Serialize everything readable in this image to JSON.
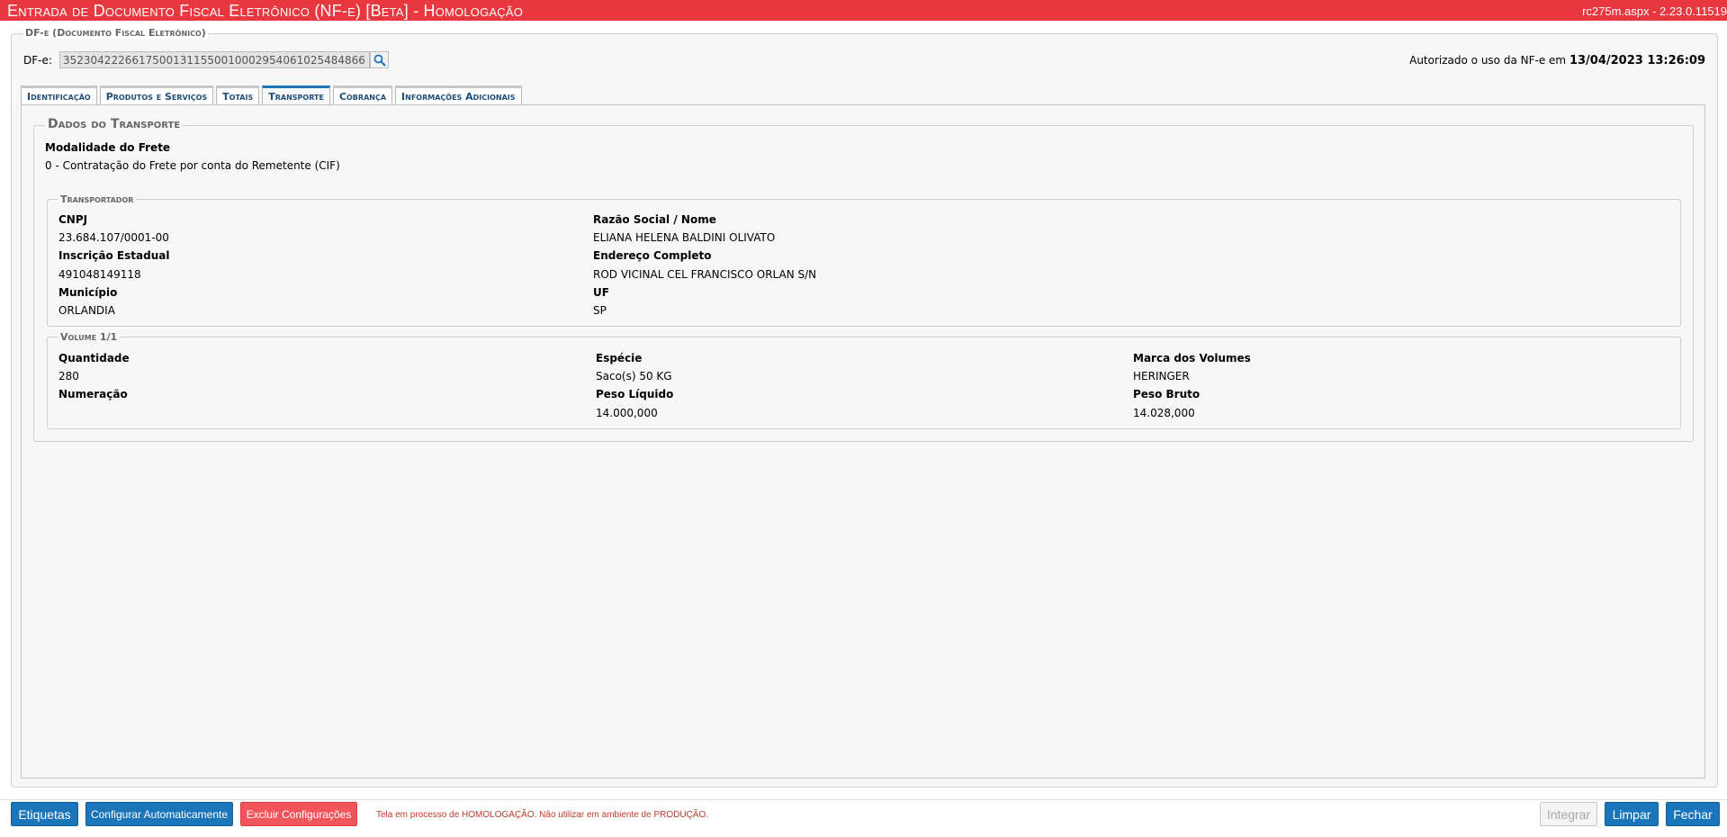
{
  "header": {
    "title": "Entrada de Documento Fiscal Eletrônico (NF-e) [Beta]  - Homologação",
    "version": "rc275m.aspx - 2.23.0.11519"
  },
  "dfe": {
    "legend": "DF-e (Documento Fiscal Eletrônico)",
    "label": "DF-e:",
    "value": "35230422266175001311550010002954061025484866",
    "autorizado_text": "Autorizado o uso da NF-e em",
    "autorizado_datetime": "13/04/2023 13:26:09"
  },
  "tabs": [
    {
      "label": "Identificação",
      "active": false
    },
    {
      "label": "Produtos e Serviços",
      "active": false
    },
    {
      "label": "Totais",
      "active": false
    },
    {
      "label": "Transporte",
      "active": true
    },
    {
      "label": "Cobrança",
      "active": false
    },
    {
      "label": "Informações Adicionais",
      "active": false
    }
  ],
  "transporte": {
    "legend": "Dados do Transporte",
    "modalidade_label": "Modalidade do Frete",
    "modalidade_value": "0 - Contratação do Frete por conta do Remetente (CIF)",
    "transportador": {
      "legend": "Transportador",
      "cnpj_label": "CNPJ",
      "cnpj_value": "23.684.107/0001-00",
      "razao_label": "Razão Social / Nome",
      "razao_value": "ELIANA HELENA BALDINI OLIVATO",
      "ie_label": "Inscrição Estadual",
      "ie_value": "491048149118",
      "endereco_label": "Endereço Completo",
      "endereco_value": "ROD VICINAL CEL FRANCISCO ORLAN S/N",
      "municipio_label": "Município",
      "municipio_value": "ORLANDIA",
      "uf_label": "UF",
      "uf_value": "SP"
    },
    "volume": {
      "legend": "Volume 1/1",
      "quantidade_label": "Quantidade",
      "quantidade_value": "280",
      "especie_label": "Espécie",
      "especie_value": "Saco(s) 50 KG",
      "marca_label": "Marca dos Volumes",
      "marca_value": "HERINGER",
      "numeracao_label": "Numeração",
      "numeracao_value": "",
      "peso_liquido_label": "Peso Líquido",
      "peso_liquido_value": "14.000,000",
      "peso_bruto_label": "Peso Bruto",
      "peso_bruto_value": "14.028,000"
    }
  },
  "footer": {
    "etiquetas": "Etiquetas",
    "configurar": "Configurar Automaticamente",
    "excluir": "Excluir Configurações",
    "warning": "Tela em processo de HOMOLOGAÇÃO. Não utilizar em ambiente de PRODUÇÃO.",
    "integrar": "Integrar",
    "limpar": "Limpar",
    "fechar": "Fechar"
  },
  "colors": {
    "header_bg": "#e8373f",
    "primary_button": "#1a75bb",
    "danger_button": "#f2545b",
    "active_tab": "#1a75bb",
    "warning_text": "#c0392b"
  },
  "icons": {
    "search": "search-icon"
  }
}
